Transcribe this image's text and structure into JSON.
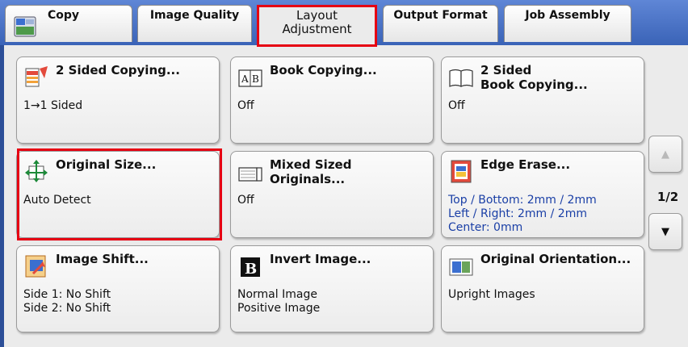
{
  "tabs": {
    "copy": "Copy",
    "image_quality": "Image Quality",
    "layout_adjustment": "Layout\nAdjustment",
    "output_format": "Output Format",
    "job_assembly": "Job Assembly"
  },
  "buttons": [
    {
      "title": "2 Sided Copying...",
      "value": "1→1 Sided",
      "icon": "duplex-copy-icon"
    },
    {
      "title": "Book Copying...",
      "value": "Off",
      "icon": "book-ab-icon"
    },
    {
      "title": "2 Sided\nBook Copying...",
      "value": "Off",
      "icon": "open-book-icon"
    },
    {
      "title": "Original Size...",
      "value": "Auto Detect",
      "icon": "resize-arrows-icon"
    },
    {
      "title": "Mixed Sized Originals...",
      "value": "Off",
      "icon": "mixed-sizes-icon"
    },
    {
      "title": "Edge Erase...",
      "value": "Top / Bottom: 2mm / 2mm\nLeft / Right: 2mm / 2mm\nCenter: 0mm",
      "icon": "edge-erase-icon"
    },
    {
      "title": "Image Shift...",
      "value": "Side 1: No Shift\nSide 2: No Shift",
      "icon": "image-shift-icon"
    },
    {
      "title": "Invert Image...",
      "value": "Normal Image\nPositive Image",
      "icon": "invert-image-icon"
    },
    {
      "title": "Original Orientation...",
      "value": "Upright Images",
      "icon": "orientation-icon"
    }
  ],
  "pager": {
    "text": "1/2",
    "up": "▲",
    "down": "▼"
  },
  "colors": {
    "accent_red": "#e60012",
    "tab_blue": "#3a63b7",
    "value_blue": "#1a3fa6"
  }
}
